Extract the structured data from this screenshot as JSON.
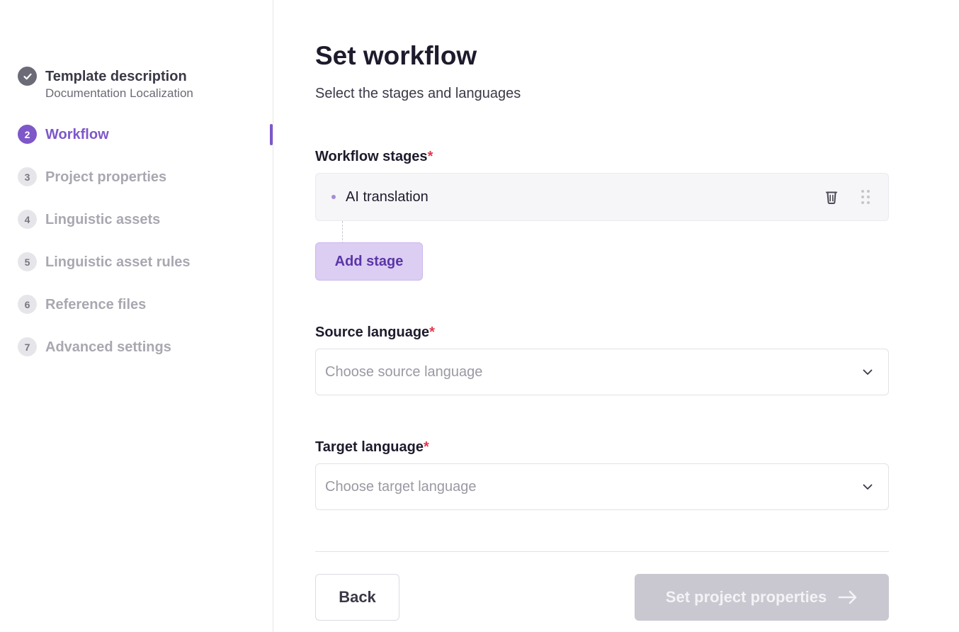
{
  "sidebar": {
    "steps": [
      {
        "number": "✓",
        "label": "Template description",
        "sub": "Documentation Localization",
        "state": "done"
      },
      {
        "number": "2",
        "label": "Workflow",
        "state": "active"
      },
      {
        "number": "3",
        "label": "Project properties",
        "state": "todo"
      },
      {
        "number": "4",
        "label": "Linguistic assets",
        "state": "todo"
      },
      {
        "number": "5",
        "label": "Linguistic asset rules",
        "state": "todo"
      },
      {
        "number": "6",
        "label": "Reference files",
        "state": "todo"
      },
      {
        "number": "7",
        "label": "Advanced settings",
        "state": "todo"
      }
    ]
  },
  "main": {
    "title": "Set workflow",
    "subtitle": "Select the stages and languages",
    "workflow_stages": {
      "label": "Workflow stages",
      "required_mark": "*",
      "stages": [
        {
          "name": "AI translation"
        }
      ],
      "add_stage_label": "Add stage"
    },
    "source_language": {
      "label": "Source language",
      "required_mark": "*",
      "placeholder": "Choose source language"
    },
    "target_language": {
      "label": "Target language",
      "required_mark": "*",
      "placeholder": "Choose target language"
    },
    "footer": {
      "back_label": "Back",
      "next_label": "Set project properties"
    }
  },
  "colors": {
    "accent": "#7e57c9",
    "accent_light": "#dccdf3",
    "required": "#e5364d",
    "disabled_button": "#c9c8d1"
  },
  "icons": {
    "done": "check-icon",
    "trash": "trash-icon",
    "drag": "drag-handle-icon",
    "chevron": "chevron-down-icon",
    "arrow": "arrow-right-icon"
  }
}
